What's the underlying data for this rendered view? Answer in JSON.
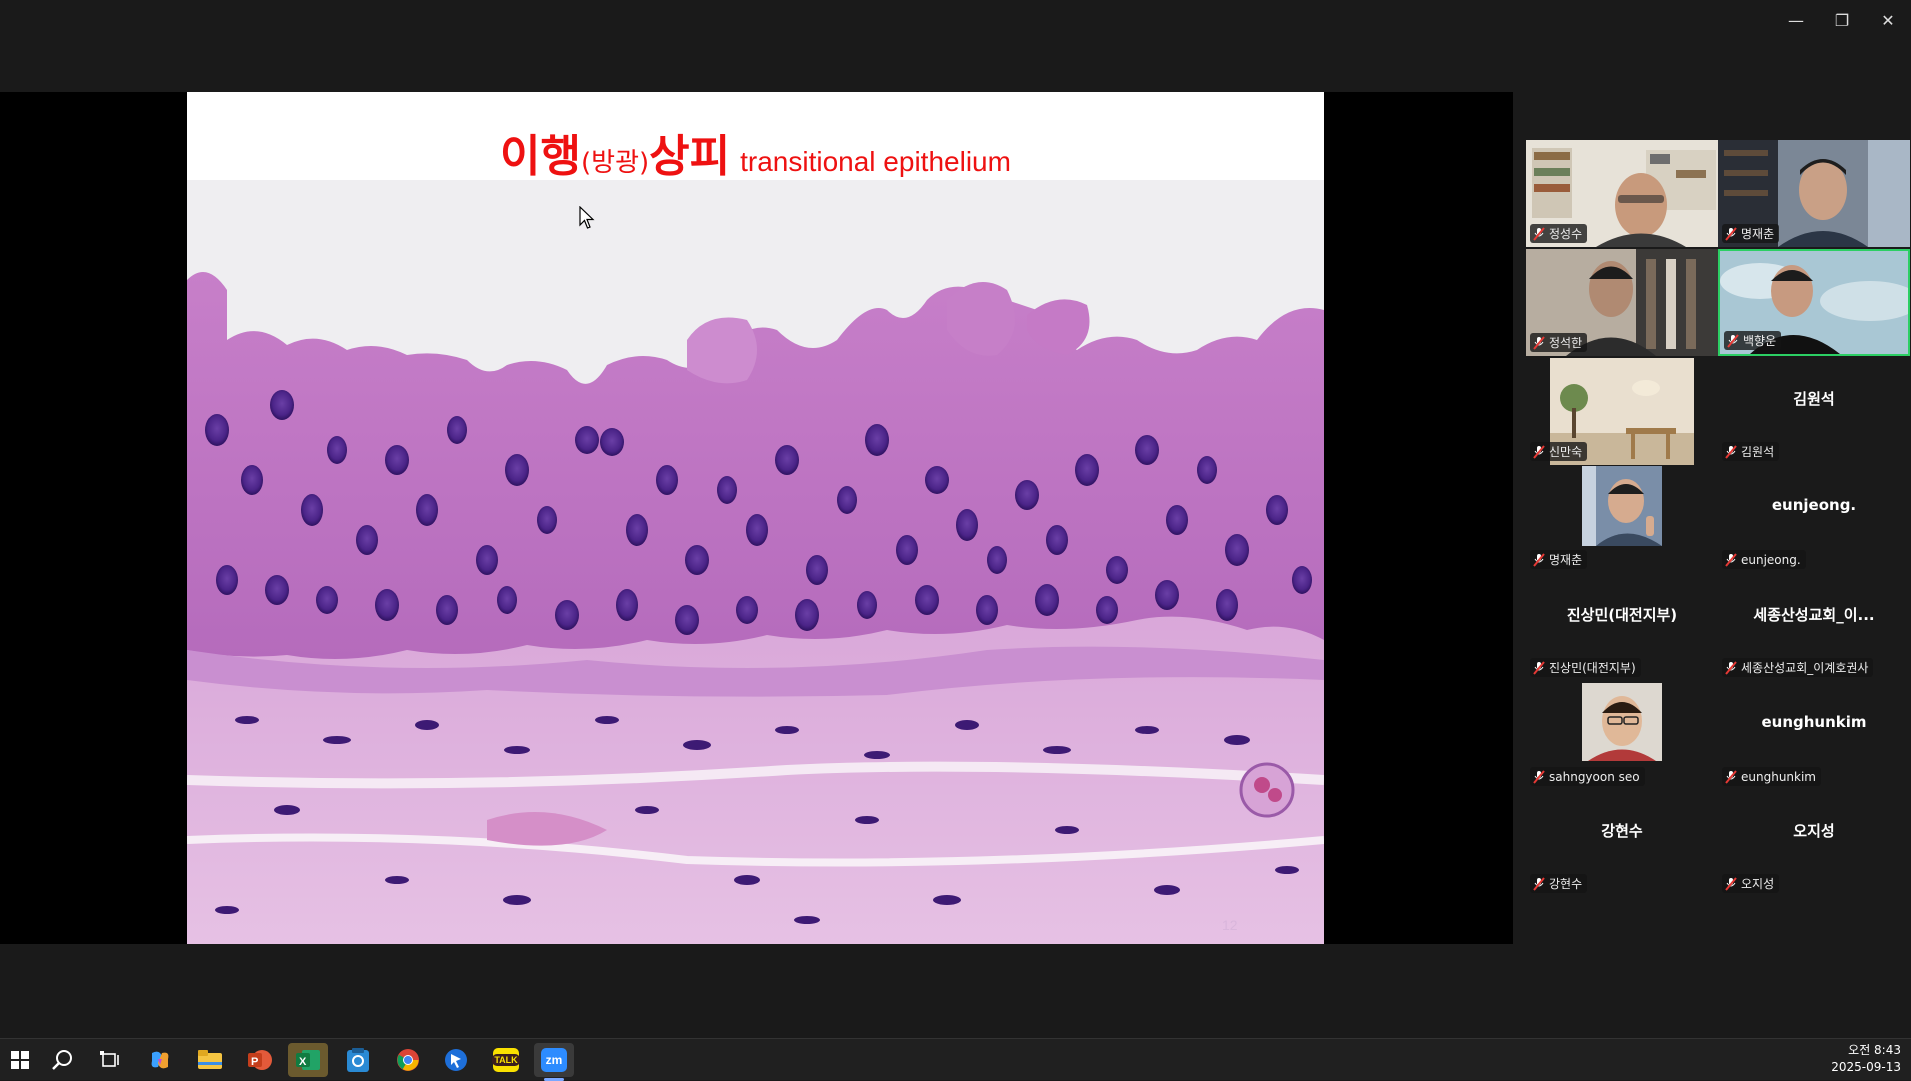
{
  "window": {
    "controls": {
      "minimize": "—",
      "restore": "❐",
      "close": "✕"
    }
  },
  "slide": {
    "title_part1": "이행",
    "title_part2": "(방광)",
    "title_part3": "상피",
    "title_en": "transitional epithelium",
    "watermark": "12"
  },
  "gallery": {
    "participants": [
      {
        "name": "정성수",
        "video": true
      },
      {
        "name": "명재춘",
        "video": true
      },
      {
        "name": "정석한",
        "video": true
      },
      {
        "name": "백향운",
        "video": true,
        "active_speaker": true
      },
      {
        "name": "신만숙",
        "video": true
      },
      {
        "name": "김원석",
        "video": false
      },
      {
        "name": "명재춘",
        "video": true
      },
      {
        "name": "eunjeong.",
        "video": false
      },
      {
        "name": "진상민(대전지부)",
        "video": false,
        "center_name": "진상민(대전지부)"
      },
      {
        "name": "세종산성교회_이계호권사",
        "video": false,
        "center_name": "세종산성교회_이..."
      },
      {
        "name": "sahngyoon seo",
        "video": true
      },
      {
        "name": "eunghunkim",
        "video": false
      },
      {
        "name": "강현수",
        "video": false
      },
      {
        "name": "오지성",
        "video": false
      }
    ]
  },
  "taskbar": {
    "apps": [
      "start-icon",
      "search-icon",
      "task-view-icon",
      "copilot-icon",
      "file-explorer-icon",
      "powerpoint-icon",
      "excel-icon",
      "app-icon",
      "chrome-icon",
      "app-icon",
      "kakaotalk-icon",
      "zoom-icon"
    ],
    "kakaotalk_label": "TALK",
    "zoom_label": "zm",
    "time": "오전 8:43",
    "date": "2025-09-13"
  },
  "colors": {
    "title_red": "#ee1111",
    "speaker_border": "#2ccf64",
    "background": "#1a1a1a"
  }
}
